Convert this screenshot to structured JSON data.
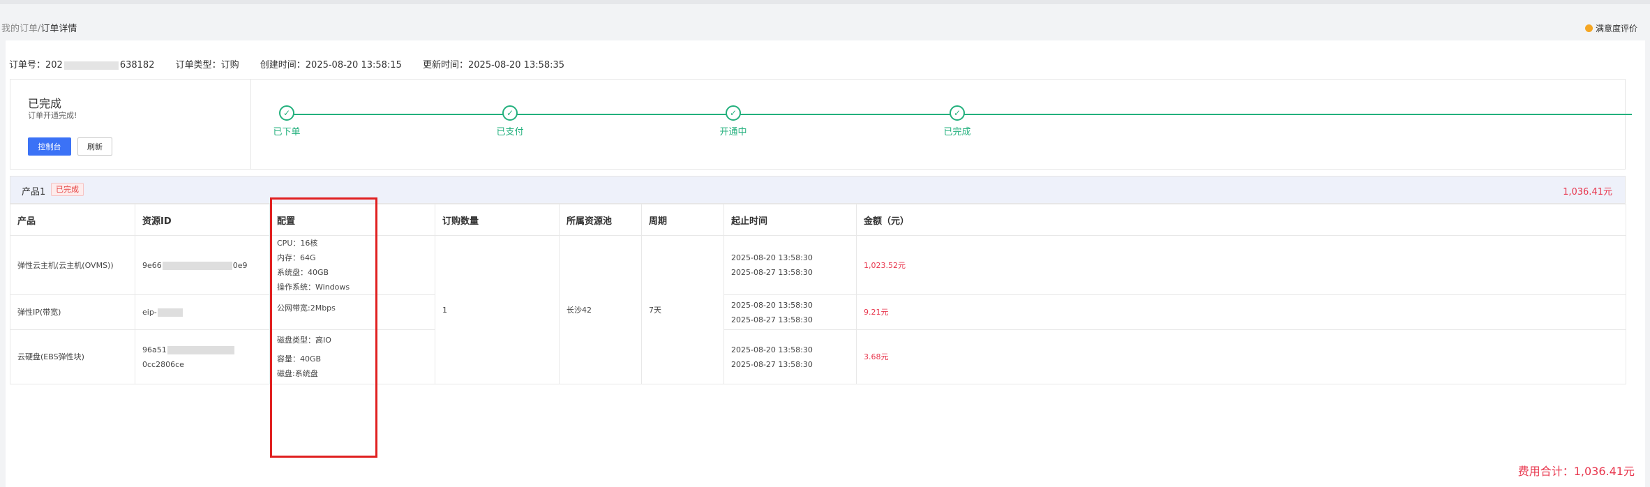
{
  "breadcrumb": {
    "parent": "我的订单",
    "separator": "/",
    "current": "订单详情"
  },
  "rating_link": "满意度评价",
  "order_meta": {
    "order_no_label": "订单号：",
    "order_no_prefix": "202",
    "order_no_suffix": "638182",
    "order_type": "订单类型：订购",
    "created": "创建时间：2025-08-20 13:58:15",
    "updated": "更新时间：2025-08-20 13:58:35"
  },
  "status": {
    "title": "已完成",
    "subtitle": "订单开通完成!",
    "console_button": "控制台",
    "refresh_button": "刷新"
  },
  "steps": [
    "已下单",
    "已支付",
    "开通中",
    "已完成"
  ],
  "product": {
    "name": "产品1",
    "badge": "已完成",
    "amount": "1,036.41元"
  },
  "table": {
    "headers": [
      "产品",
      "资源ID",
      "配置",
      "订购数量",
      "所属资源池",
      "周期",
      "起止时间",
      "金额（元）"
    ],
    "shared": {
      "quantity": "1",
      "pool": "长沙42",
      "period": "7天"
    },
    "rows": [
      {
        "product": "弹性云主机(云主机(OVMS))",
        "resource_prefix": "9e66",
        "resource_suffix": "0e9",
        "config": [
          "CPU：16核",
          "内存：64G",
          "系统盘：40GB",
          "操作系统：Windows"
        ],
        "start": "2025-08-20 13:58:30",
        "end": "2025-08-27 13:58:30",
        "amount": "1,023.52元"
      },
      {
        "product": "弹性IP(带宽)",
        "resource_prefix": "eip-",
        "resource_suffix": "",
        "config": [
          "公网带宽:2Mbps"
        ],
        "start": "2025-08-20 13:58:30",
        "end": "2025-08-27 13:58:30",
        "amount": "9.21元"
      },
      {
        "product": "云硬盘(EBS弹性块)",
        "resource_prefix": "96a51",
        "resource_suffix": "0cc2806ce",
        "config": [
          "磁盘类型：高IO",
          "",
          "容量：40GB",
          "磁盘:系统盘"
        ],
        "start": "2025-08-20 13:58:30",
        "end": "2025-08-27 13:58:30",
        "amount": "3.68元"
      }
    ]
  },
  "fee_total": "费用合计：1,036.41元",
  "colors": {
    "primary": "#3b72f6",
    "success": "#23b07d",
    "danger": "#e8364d",
    "highlight_box": "#e02020"
  }
}
